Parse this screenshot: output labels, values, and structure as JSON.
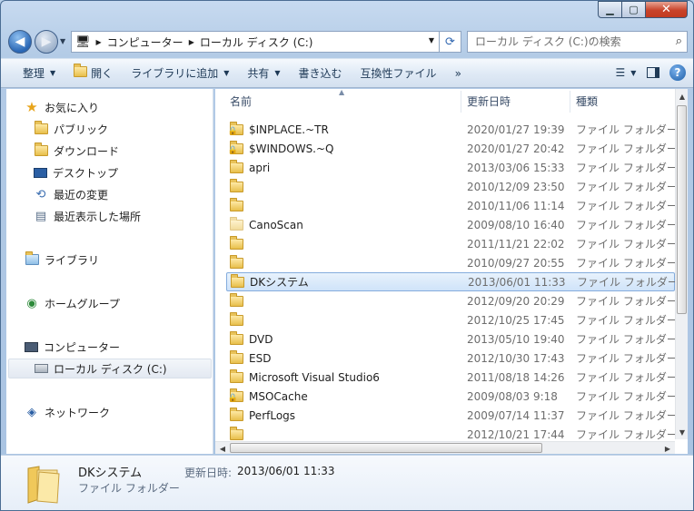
{
  "address": {
    "crumbs": [
      "コンピューター",
      "ローカル ディスク (C:)"
    ]
  },
  "search": {
    "placeholder": "ローカル ディスク (C:)の検索"
  },
  "toolbar": {
    "organize": "整理",
    "open": "開く",
    "add_to_library": "ライブラリに追加",
    "share": "共有",
    "burn": "書き込む",
    "compat_files": "互換性ファイル",
    "more": "»"
  },
  "nav": {
    "favorites": "お気に入り",
    "public": "パブリック",
    "downloads": "ダウンロード",
    "desktop": "デスクトップ",
    "recent_changes": "最近の変更",
    "recent_places": "最近表示した場所",
    "libraries": "ライブラリ",
    "homegroup": "ホームグループ",
    "computer": "コンピューター",
    "local_disk": "ローカル ディスク (C:)",
    "network": "ネットワーク"
  },
  "columns": {
    "name": "名前",
    "modified": "更新日時",
    "type": "種類"
  },
  "files": [
    {
      "name": "$INPLACE.~TR",
      "date": "2020/01/27 19:39",
      "type": "ファイル フォルダー",
      "icon": "locked-folder"
    },
    {
      "name": "$WINDOWS.~Q",
      "date": "2020/01/27 20:42",
      "type": "ファイル フォルダー",
      "icon": "locked-folder"
    },
    {
      "name": "apri",
      "date": "2013/03/06 15:33",
      "type": "ファイル フォルダー",
      "icon": "folder"
    },
    {
      "name": "",
      "date": "2010/12/09 23:50",
      "type": "ファイル フォルダー",
      "icon": "folder"
    },
    {
      "name": "",
      "date": "2010/11/06 11:14",
      "type": "ファイル フォルダー",
      "icon": "folder"
    },
    {
      "name": "CanoScan",
      "date": "2009/08/10 16:40",
      "type": "ファイル フォルダー",
      "icon": "faded-folder"
    },
    {
      "name": "",
      "date": "2011/11/21 22:02",
      "type": "ファイル フォルダー",
      "icon": "folder"
    },
    {
      "name": "",
      "date": "2010/09/27 20:55",
      "type": "ファイル フォルダー",
      "icon": "folder"
    },
    {
      "name": "DKシステム",
      "date": "2013/06/01 11:33",
      "type": "ファイル フォルダー",
      "icon": "folder",
      "selected": true
    },
    {
      "name": "",
      "date": "2012/09/20 20:29",
      "type": "ファイル フォルダー",
      "icon": "folder"
    },
    {
      "name": "",
      "date": "2012/10/25 17:45",
      "type": "ファイル フォルダー",
      "icon": "folder"
    },
    {
      "name": "DVD",
      "date": "2013/05/10 19:40",
      "type": "ファイル フォルダー",
      "icon": "folder"
    },
    {
      "name": "ESD",
      "date": "2012/10/30 17:43",
      "type": "ファイル フォルダー",
      "icon": "folder"
    },
    {
      "name": "Microsoft Visual Studio6",
      "date": "2011/08/18 14:26",
      "type": "ファイル フォルダー",
      "icon": "folder"
    },
    {
      "name": "MSOCache",
      "date": "2009/08/03 9:18",
      "type": "ファイル フォルダー",
      "icon": "locked-folder"
    },
    {
      "name": "PerfLogs",
      "date": "2009/07/14 11:37",
      "type": "ファイル フォルダー",
      "icon": "folder"
    },
    {
      "name": "",
      "date": "2012/10/21 17:44",
      "type": "ファイル フォルダー",
      "icon": "folder"
    }
  ],
  "details": {
    "name": "DKシステム",
    "type": "ファイル フォルダー",
    "modified_label": "更新日時:",
    "modified_value": "2013/06/01 11:33"
  }
}
